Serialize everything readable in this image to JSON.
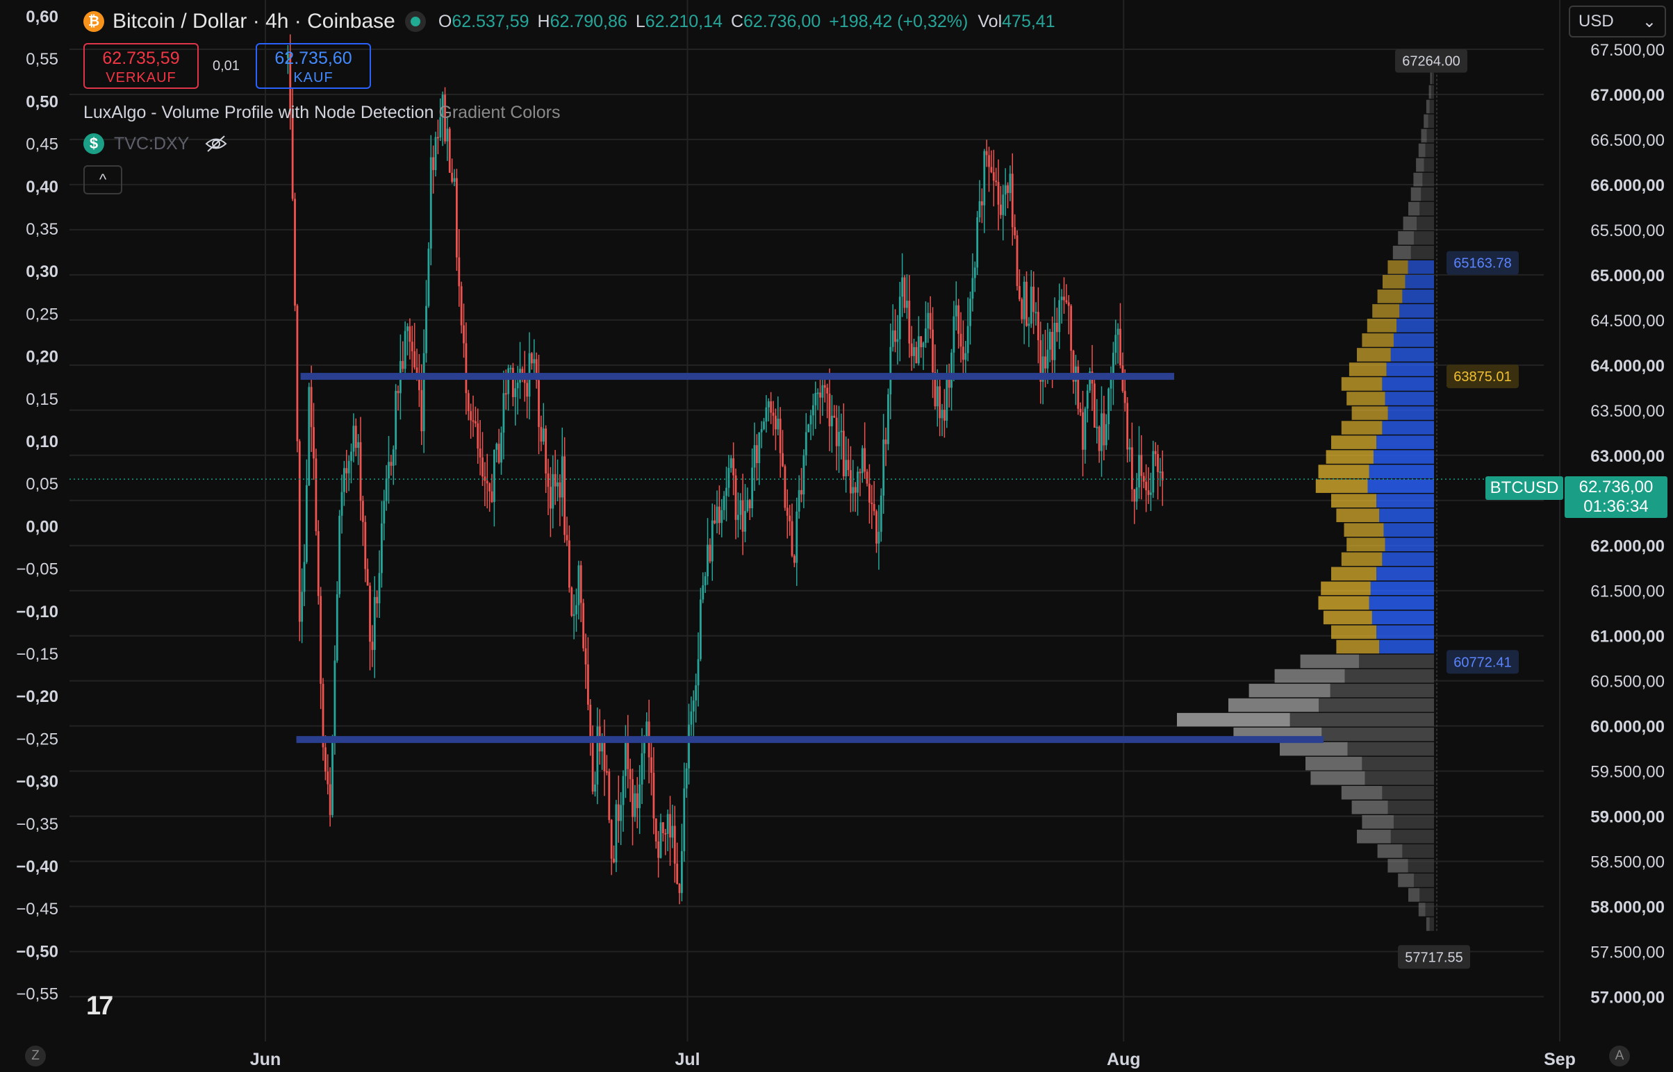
{
  "header": {
    "coin_icon": "bitcoin-icon",
    "coin_icon_glyph": "₿",
    "title": "Bitcoin / Dollar · 4h · Coinbase",
    "open_label": "O",
    "open": "62.537,59",
    "high_label": "H",
    "high": "62.790,86",
    "low_label": "L",
    "low": "62.210,14",
    "close_label": "C",
    "close": "62.736,00",
    "change": "+198,42 (+0,32%)",
    "vol_label": "Vol",
    "volume": "475,41"
  },
  "trade": {
    "sell_price": "62.735,59",
    "sell_label": "VERKAUF",
    "spread": "0,01",
    "buy_price": "62.735,60",
    "buy_label": "KAUF"
  },
  "indicator": {
    "name": "LuxAlgo - Volume Profile with Node Detection",
    "option": "Gradient Colors"
  },
  "compare": {
    "icon": "dollar-icon",
    "icon_glyph": "$",
    "symbol": "TVC:DXY"
  },
  "collapse_glyph": "^",
  "currency": {
    "value": "USD",
    "arrow": "⌄"
  },
  "corner_left": "Z",
  "corner_right": "A",
  "logo_text": "17",
  "last_price": {
    "symbol": "BTCUSD",
    "price": "62.736,00",
    "countdown": "01:36:34"
  },
  "colors": {
    "background": "#0e0e0e",
    "up": "#26a69a",
    "down": "#ef5350",
    "profile_blue": "#2962ff",
    "profile_yellow": "#f0c030",
    "profile_gray": "#8a8a8a",
    "node_line": "#2a3f8f"
  },
  "chart_data": {
    "type": "candlestick",
    "right_axis": {
      "ylim": [
        56750,
        68000
      ],
      "ticks": [
        57000,
        57500,
        58000,
        58500,
        59000,
        59500,
        60000,
        60500,
        61000,
        61500,
        62000,
        62500,
        63000,
        63500,
        64000,
        64500,
        65000,
        65500,
        66000,
        66500,
        67000,
        67500
      ],
      "tick_labels": [
        "57.000,00",
        "57.500,00",
        "58.000,00",
        "58.500,00",
        "59.000,00",
        "59.500,00",
        "60.000,00",
        "60.500,00",
        "61.000,00",
        "61.500,00",
        "62.000,00",
        "62.500,00",
        "63.000,00",
        "63.500,00",
        "64.000,00",
        "64.500,00",
        "65.000,00",
        "65.500,00",
        "66.000,00",
        "66.500,00",
        "67.000,00",
        "67.500,00"
      ]
    },
    "left_axis": {
      "tick_labels": [
        "0,60",
        "0,55",
        "0,50",
        "0,45",
        "0,40",
        "0,35",
        "0,30",
        "0,25",
        "0,20",
        "0,15",
        "0,10",
        "0,05",
        "0,00",
        "−0,05",
        "−0,10",
        "−0,15",
        "−0,20",
        "−0,25",
        "−0,30",
        "−0,35",
        "−0,40",
        "−0,45",
        "−0,50",
        "−0,55"
      ]
    },
    "x_axis": {
      "labels": [
        "Jun",
        "Jul",
        "Aug",
        "Sep"
      ],
      "label_days": [
        0,
        30,
        61,
        92
      ]
    },
    "series": {
      "anchors": [
        [
          1.6,
          67400
        ],
        [
          2.0,
          65300
        ],
        [
          2.5,
          60800
        ],
        [
          3.1,
          63600
        ],
        [
          3.6,
          62400
        ],
        [
          4.0,
          59900
        ],
        [
          4.6,
          58900
        ],
        [
          5.2,
          62100
        ],
        [
          6.1,
          63300
        ],
        [
          6.7,
          62900
        ],
        [
          7.5,
          60800
        ],
        [
          8.7,
          62700
        ],
        [
          9.5,
          63900
        ],
        [
          10.2,
          64400
        ],
        [
          11.1,
          63500
        ],
        [
          11.8,
          66300
        ],
        [
          12.5,
          66900
        ],
        [
          13.3,
          66200
        ],
        [
          14.0,
          64200
        ],
        [
          14.9,
          63200
        ],
        [
          15.7,
          62400
        ],
        [
          16.5,
          63000
        ],
        [
          17.3,
          64000
        ],
        [
          18.2,
          63700
        ],
        [
          19.0,
          64100
        ],
        [
          20.3,
          62500
        ],
        [
          21.1,
          62800
        ],
        [
          21.7,
          61000
        ],
        [
          22.3,
          61800
        ],
        [
          23.2,
          59300
        ],
        [
          23.9,
          60100
        ],
        [
          24.7,
          58600
        ],
        [
          25.5,
          59700
        ],
        [
          26.3,
          59000
        ],
        [
          27.1,
          60100
        ],
        [
          27.9,
          58500
        ],
        [
          28.6,
          59200
        ],
        [
          29.3,
          58100
        ],
        [
          30.1,
          59800
        ],
        [
          31.0,
          61400
        ],
        [
          32.0,
          62400
        ],
        [
          33.0,
          62800
        ],
        [
          34.0,
          62200
        ],
        [
          35.0,
          63100
        ],
        [
          35.8,
          63800
        ],
        [
          36.7,
          62900
        ],
        [
          37.5,
          61800
        ],
        [
          38.4,
          63300
        ],
        [
          39.5,
          63800
        ],
        [
          40.5,
          63400
        ],
        [
          41.5,
          62600
        ],
        [
          42.5,
          63000
        ],
        [
          43.5,
          62200
        ],
        [
          44.5,
          64100
        ],
        [
          45.3,
          64900
        ],
        [
          46.2,
          64000
        ],
        [
          47.0,
          64600
        ],
        [
          48.0,
          63200
        ],
        [
          49.0,
          64500
        ],
        [
          49.8,
          64100
        ],
        [
          50.6,
          65400
        ],
        [
          51.3,
          66400
        ],
        [
          52.1,
          65800
        ],
        [
          52.8,
          66100
        ],
        [
          53.6,
          64800
        ],
        [
          54.5,
          64600
        ],
        [
          55.2,
          63900
        ],
        [
          56.0,
          64300
        ],
        [
          56.8,
          64800
        ],
        [
          57.4,
          64000
        ],
        [
          58.0,
          63200
        ],
        [
          58.6,
          63900
        ],
        [
          59.3,
          63100
        ],
        [
          60.0,
          63700
        ],
        [
          60.6,
          64400
        ],
        [
          61.2,
          63400
        ],
        [
          61.7,
          62600
        ],
        [
          62.2,
          62900
        ],
        [
          62.6,
          62600
        ],
        [
          63.2,
          63000
        ],
        [
          63.8,
          62736
        ]
      ]
    },
    "volume_profile": {
      "rows": 59,
      "price_range": [
        57717.55,
        67264.0
      ],
      "widths": [
        1.5,
        2,
        3,
        4,
        5,
        6,
        7,
        8,
        9,
        10,
        12,
        14,
        16,
        18,
        20,
        22,
        24,
        26,
        28,
        30,
        33,
        36,
        34,
        32,
        36,
        40,
        42,
        45,
        46,
        40,
        38,
        35,
        34,
        36,
        40,
        44,
        45,
        43,
        40,
        38,
        52,
        62,
        72,
        80,
        100,
        78,
        60,
        50,
        48,
        36,
        32,
        28,
        30,
        22,
        18,
        14,
        10,
        6,
        3
      ],
      "value_area_high": "65163.78",
      "poc": "63875.01",
      "value_area_low": "60772.41",
      "profile_high": "67264.00",
      "profile_low": "57717.55",
      "nodes": [
        63875,
        59850
      ]
    }
  }
}
